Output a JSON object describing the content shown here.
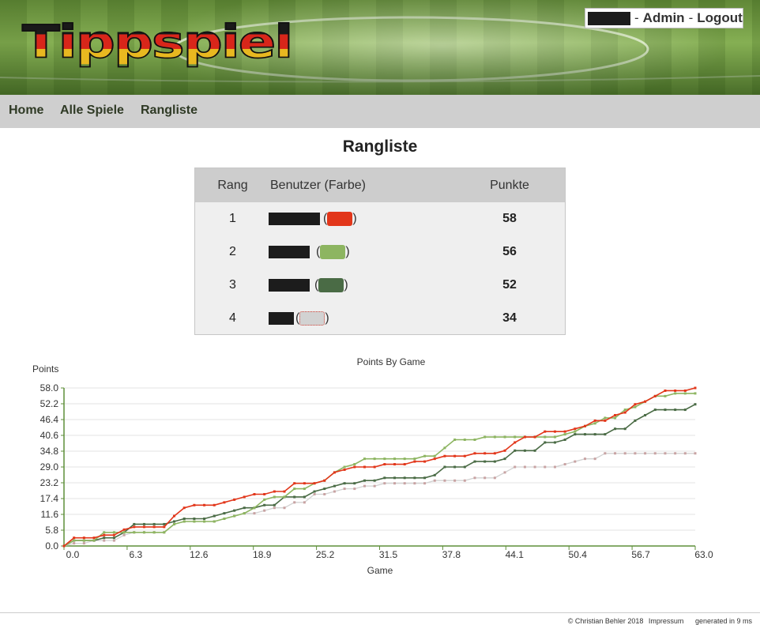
{
  "header": {
    "logo_text": "Tippspiel",
    "user": {
      "separator1": "-",
      "admin_label": "Admin",
      "separator2": "-",
      "logout_label": "Logout"
    }
  },
  "nav": {
    "items": [
      "Home",
      "Alle Spiele",
      "Rangliste"
    ]
  },
  "page_title": "Rangliste",
  "table": {
    "headers": {
      "rang": "Rang",
      "user": "Benutzer (Farbe)",
      "points": "Punkte"
    },
    "rows": [
      {
        "rank": "1",
        "color": "#e2361a",
        "points": "58"
      },
      {
        "rank": "2",
        "color": "#8db561",
        "points": "56"
      },
      {
        "rank": "3",
        "color": "#4a6b45",
        "points": "52"
      },
      {
        "rank": "4",
        "color": "#d2d2d2",
        "points": "34"
      }
    ]
  },
  "chart_data": {
    "type": "line",
    "title": "Points By Game",
    "xlabel": "Game",
    "ylabel": "Points",
    "xlim": [
      0,
      63
    ],
    "ylim": [
      0,
      58
    ],
    "x_ticks": [
      "0.0",
      "6.3",
      "12.6",
      "18.9",
      "25.2",
      "31.5",
      "37.8",
      "44.1",
      "50.4",
      "56.7",
      "63.0"
    ],
    "y_ticks": [
      "0.0",
      "5.8",
      "11.6",
      "17.4",
      "23.2",
      "29.0",
      "34.8",
      "40.6",
      "46.4",
      "52.2",
      "58.0"
    ],
    "grid": true,
    "legend": "none",
    "series": [
      {
        "color": "#e2361a",
        "values": [
          [
            0,
            0
          ],
          [
            1,
            3
          ],
          [
            2,
            3
          ],
          [
            3,
            3
          ],
          [
            4,
            4
          ],
          [
            5,
            4
          ],
          [
            6,
            6
          ],
          [
            7,
            7
          ],
          [
            8,
            7
          ],
          [
            9,
            7
          ],
          [
            10,
            7
          ],
          [
            11,
            11
          ],
          [
            12,
            14
          ],
          [
            13,
            15
          ],
          [
            14,
            15
          ],
          [
            15,
            15
          ],
          [
            16,
            16
          ],
          [
            17,
            17
          ],
          [
            18,
            18
          ],
          [
            19,
            19
          ],
          [
            20,
            19
          ],
          [
            21,
            20
          ],
          [
            22,
            20
          ],
          [
            23,
            23
          ],
          [
            24,
            23
          ],
          [
            25,
            23
          ],
          [
            26,
            24
          ],
          [
            27,
            27
          ],
          [
            28,
            28
          ],
          [
            29,
            29
          ],
          [
            30,
            29
          ],
          [
            31,
            29
          ],
          [
            32,
            30
          ],
          [
            33,
            30
          ],
          [
            34,
            30
          ],
          [
            35,
            31
          ],
          [
            36,
            31
          ],
          [
            37,
            32
          ],
          [
            38,
            33
          ],
          [
            39,
            33
          ],
          [
            40,
            33
          ],
          [
            41,
            34
          ],
          [
            42,
            34
          ],
          [
            43,
            34
          ],
          [
            44,
            35
          ],
          [
            45,
            38
          ],
          [
            46,
            40
          ],
          [
            47,
            40
          ],
          [
            48,
            42
          ],
          [
            49,
            42
          ],
          [
            50,
            42
          ],
          [
            51,
            43
          ],
          [
            52,
            44
          ],
          [
            53,
            46
          ],
          [
            54,
            46
          ],
          [
            55,
            48
          ],
          [
            56,
            49
          ],
          [
            57,
            52
          ],
          [
            58,
            53
          ],
          [
            59,
            55
          ],
          [
            60,
            57
          ],
          [
            61,
            57
          ],
          [
            62,
            57
          ],
          [
            63,
            58
          ]
        ]
      },
      {
        "color": "#8db561",
        "values": [
          [
            0,
            0
          ],
          [
            1,
            2
          ],
          [
            2,
            2
          ],
          [
            3,
            2
          ],
          [
            4,
            5
          ],
          [
            5,
            5
          ],
          [
            6,
            5
          ],
          [
            7,
            5
          ],
          [
            8,
            5
          ],
          [
            9,
            5
          ],
          [
            10,
            5
          ],
          [
            11,
            8
          ],
          [
            12,
            9
          ],
          [
            13,
            9
          ],
          [
            14,
            9
          ],
          [
            15,
            9
          ],
          [
            16,
            10
          ],
          [
            17,
            11
          ],
          [
            18,
            12
          ],
          [
            19,
            14
          ],
          [
            20,
            17
          ],
          [
            21,
            18
          ],
          [
            22,
            18
          ],
          [
            23,
            21
          ],
          [
            24,
            21
          ],
          [
            25,
            23
          ],
          [
            26,
            24
          ],
          [
            27,
            27
          ],
          [
            28,
            29
          ],
          [
            29,
            30
          ],
          [
            30,
            32
          ],
          [
            31,
            32
          ],
          [
            32,
            32
          ],
          [
            33,
            32
          ],
          [
            34,
            32
          ],
          [
            35,
            32
          ],
          [
            36,
            33
          ],
          [
            37,
            33
          ],
          [
            38,
            36
          ],
          [
            39,
            39
          ],
          [
            40,
            39
          ],
          [
            41,
            39
          ],
          [
            42,
            40
          ],
          [
            43,
            40
          ],
          [
            44,
            40
          ],
          [
            45,
            40
          ],
          [
            46,
            40
          ],
          [
            47,
            40
          ],
          [
            48,
            40
          ],
          [
            49,
            40
          ],
          [
            50,
            41
          ],
          [
            51,
            42
          ],
          [
            52,
            44
          ],
          [
            53,
            45
          ],
          [
            54,
            47
          ],
          [
            55,
            47
          ],
          [
            56,
            50
          ],
          [
            57,
            51
          ],
          [
            58,
            53
          ],
          [
            59,
            55
          ],
          [
            60,
            55
          ],
          [
            61,
            56
          ],
          [
            62,
            56
          ],
          [
            63,
            56
          ]
        ]
      },
      {
        "color": "#4a6b45",
        "values": [
          [
            0,
            0
          ],
          [
            1,
            2
          ],
          [
            2,
            2
          ],
          [
            3,
            2
          ],
          [
            4,
            3
          ],
          [
            5,
            3
          ],
          [
            6,
            5
          ],
          [
            7,
            8
          ],
          [
            8,
            8
          ],
          [
            9,
            8
          ],
          [
            10,
            8
          ],
          [
            11,
            9
          ],
          [
            12,
            10
          ],
          [
            13,
            10
          ],
          [
            14,
            10
          ],
          [
            15,
            11
          ],
          [
            16,
            12
          ],
          [
            17,
            13
          ],
          [
            18,
            14
          ],
          [
            19,
            14
          ],
          [
            20,
            15
          ],
          [
            21,
            15
          ],
          [
            22,
            18
          ],
          [
            23,
            18
          ],
          [
            24,
            18
          ],
          [
            25,
            20
          ],
          [
            26,
            21
          ],
          [
            27,
            22
          ],
          [
            28,
            23
          ],
          [
            29,
            23
          ],
          [
            30,
            24
          ],
          [
            31,
            24
          ],
          [
            32,
            25
          ],
          [
            33,
            25
          ],
          [
            34,
            25
          ],
          [
            35,
            25
          ],
          [
            36,
            25
          ],
          [
            37,
            26
          ],
          [
            38,
            29
          ],
          [
            39,
            29
          ],
          [
            40,
            29
          ],
          [
            41,
            31
          ],
          [
            42,
            31
          ],
          [
            43,
            31
          ],
          [
            44,
            32
          ],
          [
            45,
            35
          ],
          [
            46,
            35
          ],
          [
            47,
            35
          ],
          [
            48,
            38
          ],
          [
            49,
            38
          ],
          [
            50,
            39
          ],
          [
            51,
            41
          ],
          [
            52,
            41
          ],
          [
            53,
            41
          ],
          [
            54,
            41
          ],
          [
            55,
            43
          ],
          [
            56,
            43
          ],
          [
            57,
            46
          ],
          [
            58,
            48
          ],
          [
            59,
            50
          ],
          [
            60,
            50
          ],
          [
            61,
            50
          ],
          [
            62,
            50
          ],
          [
            63,
            52
          ]
        ]
      },
      {
        "color": "#d2d2d2",
        "values": [
          [
            0,
            0
          ],
          [
            1,
            1
          ],
          [
            2,
            1
          ],
          [
            3,
            2
          ],
          [
            4,
            2
          ],
          [
            5,
            2
          ],
          [
            6,
            4
          ],
          [
            7,
            5
          ],
          [
            8,
            5
          ],
          [
            9,
            5
          ],
          [
            10,
            5
          ],
          [
            11,
            8
          ],
          [
            12,
            9
          ],
          [
            13,
            9
          ],
          [
            14,
            9
          ],
          [
            15,
            9
          ],
          [
            16,
            10
          ],
          [
            17,
            11
          ],
          [
            18,
            12
          ],
          [
            19,
            12
          ],
          [
            20,
            13
          ],
          [
            21,
            14
          ],
          [
            22,
            14
          ],
          [
            23,
            16
          ],
          [
            24,
            16
          ],
          [
            25,
            19
          ],
          [
            26,
            19
          ],
          [
            27,
            20
          ],
          [
            28,
            21
          ],
          [
            29,
            21
          ],
          [
            30,
            22
          ],
          [
            31,
            22
          ],
          [
            32,
            23
          ],
          [
            33,
            23
          ],
          [
            34,
            23
          ],
          [
            35,
            23
          ],
          [
            36,
            23
          ],
          [
            37,
            24
          ],
          [
            38,
            24
          ],
          [
            39,
            24
          ],
          [
            40,
            24
          ],
          [
            41,
            25
          ],
          [
            42,
            25
          ],
          [
            43,
            25
          ],
          [
            44,
            27
          ],
          [
            45,
            29
          ],
          [
            46,
            29
          ],
          [
            47,
            29
          ],
          [
            48,
            29
          ],
          [
            49,
            29
          ],
          [
            50,
            30
          ],
          [
            51,
            31
          ],
          [
            52,
            32
          ],
          [
            53,
            32
          ],
          [
            54,
            34
          ],
          [
            55,
            34
          ],
          [
            56,
            34
          ],
          [
            57,
            34
          ],
          [
            58,
            34
          ],
          [
            59,
            34
          ],
          [
            60,
            34
          ],
          [
            61,
            34
          ],
          [
            62,
            34
          ],
          [
            63,
            34
          ]
        ]
      }
    ]
  },
  "footer": {
    "copyright": "© Christian Behler 2018",
    "impressum": "Impressum",
    "generated": "generated in 9 ms"
  }
}
